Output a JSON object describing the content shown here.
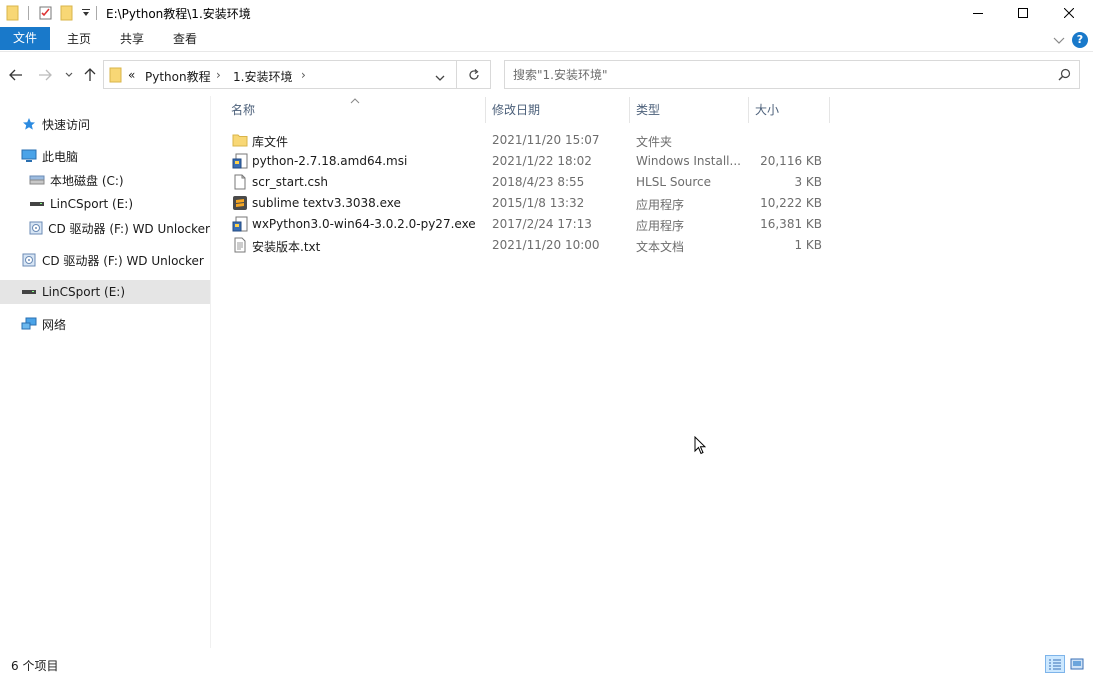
{
  "window": {
    "title": "E:\\Python教程\\1.安装环境"
  },
  "ribbon": {
    "tabs": [
      "文件",
      "主页",
      "共享",
      "查看"
    ],
    "help": "?"
  },
  "nav": {
    "breadcrumb_overflow": "«",
    "breadcrumb": [
      "Python教程",
      "1.安装环境"
    ],
    "search_placeholder": "搜索\"1.安装环境\""
  },
  "sidebar": {
    "items": [
      {
        "label": "快速访问",
        "icon": "star-icon"
      },
      {
        "label": "此电脑",
        "icon": "computer-icon"
      },
      {
        "label": "本地磁盘 (C:)",
        "icon": "drive-icon"
      },
      {
        "label": "LinCSport (E:)",
        "icon": "usb-drive-icon"
      },
      {
        "label": "CD 驱动器 (F:) WD Unlocker",
        "icon": "cd-drive-icon"
      },
      {
        "label": "CD 驱动器 (F:) WD Unlocker",
        "icon": "cd-drive-icon"
      },
      {
        "label": "LinCSport (E:)",
        "icon": "usb-drive-icon",
        "selected": true
      },
      {
        "label": "网络",
        "icon": "network-icon"
      }
    ]
  },
  "columns": {
    "name": "名称",
    "date": "修改日期",
    "type": "类型",
    "size": "大小"
  },
  "files": [
    {
      "name": "库文件",
      "date": "2021/11/20 15:07",
      "type": "文件夹",
      "size": "",
      "icon": "folder-icon"
    },
    {
      "name": "python-2.7.18.amd64.msi",
      "date": "2021/1/22 18:02",
      "type": "Windows Install...",
      "size": "20,116 KB",
      "icon": "installer-icon"
    },
    {
      "name": "scr_start.csh",
      "date": "2018/4/23 8:55",
      "type": "HLSL Source",
      "size": "3 KB",
      "icon": "file-icon"
    },
    {
      "name": "sublime textv3.3038.exe",
      "date": "2015/1/8 13:32",
      "type": "应用程序",
      "size": "10,222 KB",
      "icon": "app-icon"
    },
    {
      "name": "wxPython3.0-win64-3.0.2.0-py27.exe",
      "date": "2017/2/24 17:13",
      "type": "应用程序",
      "size": "16,381 KB",
      "icon": "installer-icon"
    },
    {
      "name": "安装版本.txt",
      "date": "2021/11/20 10:00",
      "type": "文本文档",
      "size": "1 KB",
      "icon": "text-file-icon"
    }
  ],
  "status": {
    "item_count": "6 个项目"
  },
  "colors": {
    "accent": "#1979ca",
    "folder": "#f8d775",
    "selection": "#e5e5e5",
    "header_text": "#4c607a"
  }
}
